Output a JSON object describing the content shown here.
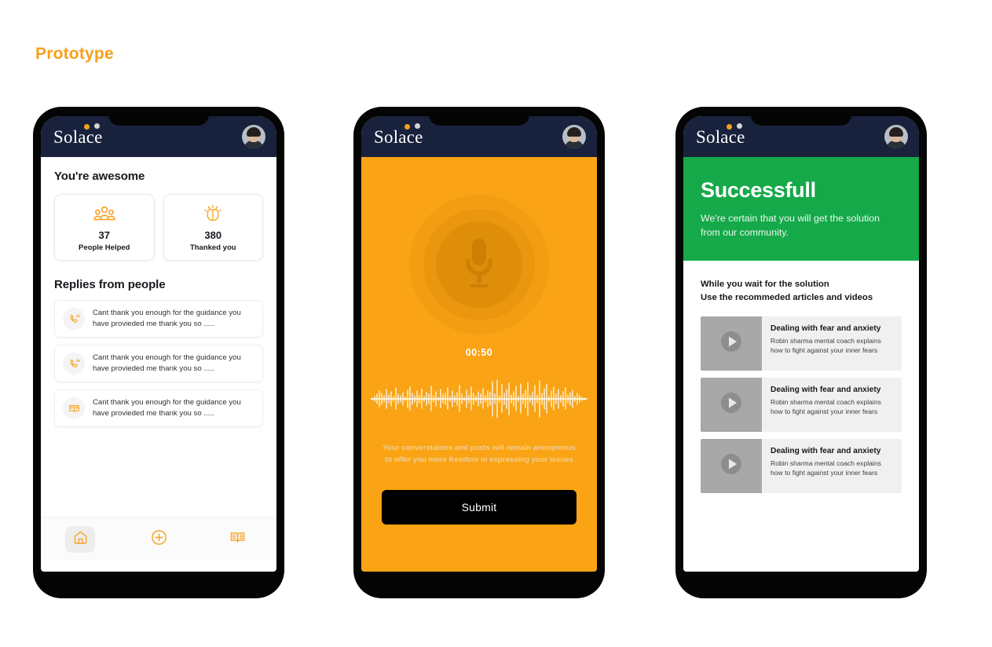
{
  "page": {
    "title": "Prototype",
    "accent_orange": "#F7A01B",
    "navy": "#18223C",
    "green": "#16A94A",
    "screen_orange": "#F9A315"
  },
  "brand": {
    "name": "Solace",
    "avatar_icon": "user-avatar-photo"
  },
  "screen1": {
    "awesome_heading": "You're awesome",
    "stats": [
      {
        "icon": "people-group-icon",
        "value": "37",
        "label": "People Helped"
      },
      {
        "icon": "praying-hands-icon",
        "value": "380",
        "label": "Thanked you"
      }
    ],
    "replies_heading": "Replies from people",
    "replies": [
      {
        "icon": "phone-ring-icon",
        "text": "Cant thank you enough for the guidance you have provieded me thank you so ....."
      },
      {
        "icon": "phone-ring-icon",
        "text": "Cant thank you enough for the guidance you have provieded me thank you so ....."
      },
      {
        "icon": "open-book-icon",
        "text": "Cant thank you enough for the guidance you have provieded me thank you so ....."
      }
    ],
    "nav": [
      {
        "icon": "home-icon",
        "label": "Home",
        "active": true
      },
      {
        "icon": "plus-circle-icon",
        "label": "Add",
        "active": false
      },
      {
        "icon": "open-book-icon",
        "label": "Library",
        "active": false
      }
    ]
  },
  "screen2": {
    "mic_icon": "microphone-icon",
    "timer": "00:50",
    "waveform_icon": "audio-waveform",
    "anonymous_note": "Your converstaions and posts will remain anonymous to offer you more freedom in expressing your issues",
    "submit_label": "Submit"
  },
  "screen3": {
    "success_title": "Successfull",
    "success_subtitle": "We're certain that you will get the solution from our community.",
    "wait_line1": "While you wait for the solution",
    "wait_line2": "Use the recommeded articles and videos",
    "videos": [
      {
        "play_icon": "play-icon",
        "title": "Dealing with fear and anxiety",
        "desc": "Robin sharma mental coach explains how to fight against your inner fears"
      },
      {
        "play_icon": "play-icon",
        "title": "Dealing with fear and anxiety",
        "desc": "Robin sharma mental coach explains how to fight against your inner fears"
      },
      {
        "play_icon": "play-icon",
        "title": "Dealing with fear and anxiety",
        "desc": "Robin sharma mental coach explains how to fight against your inner fears"
      }
    ]
  }
}
